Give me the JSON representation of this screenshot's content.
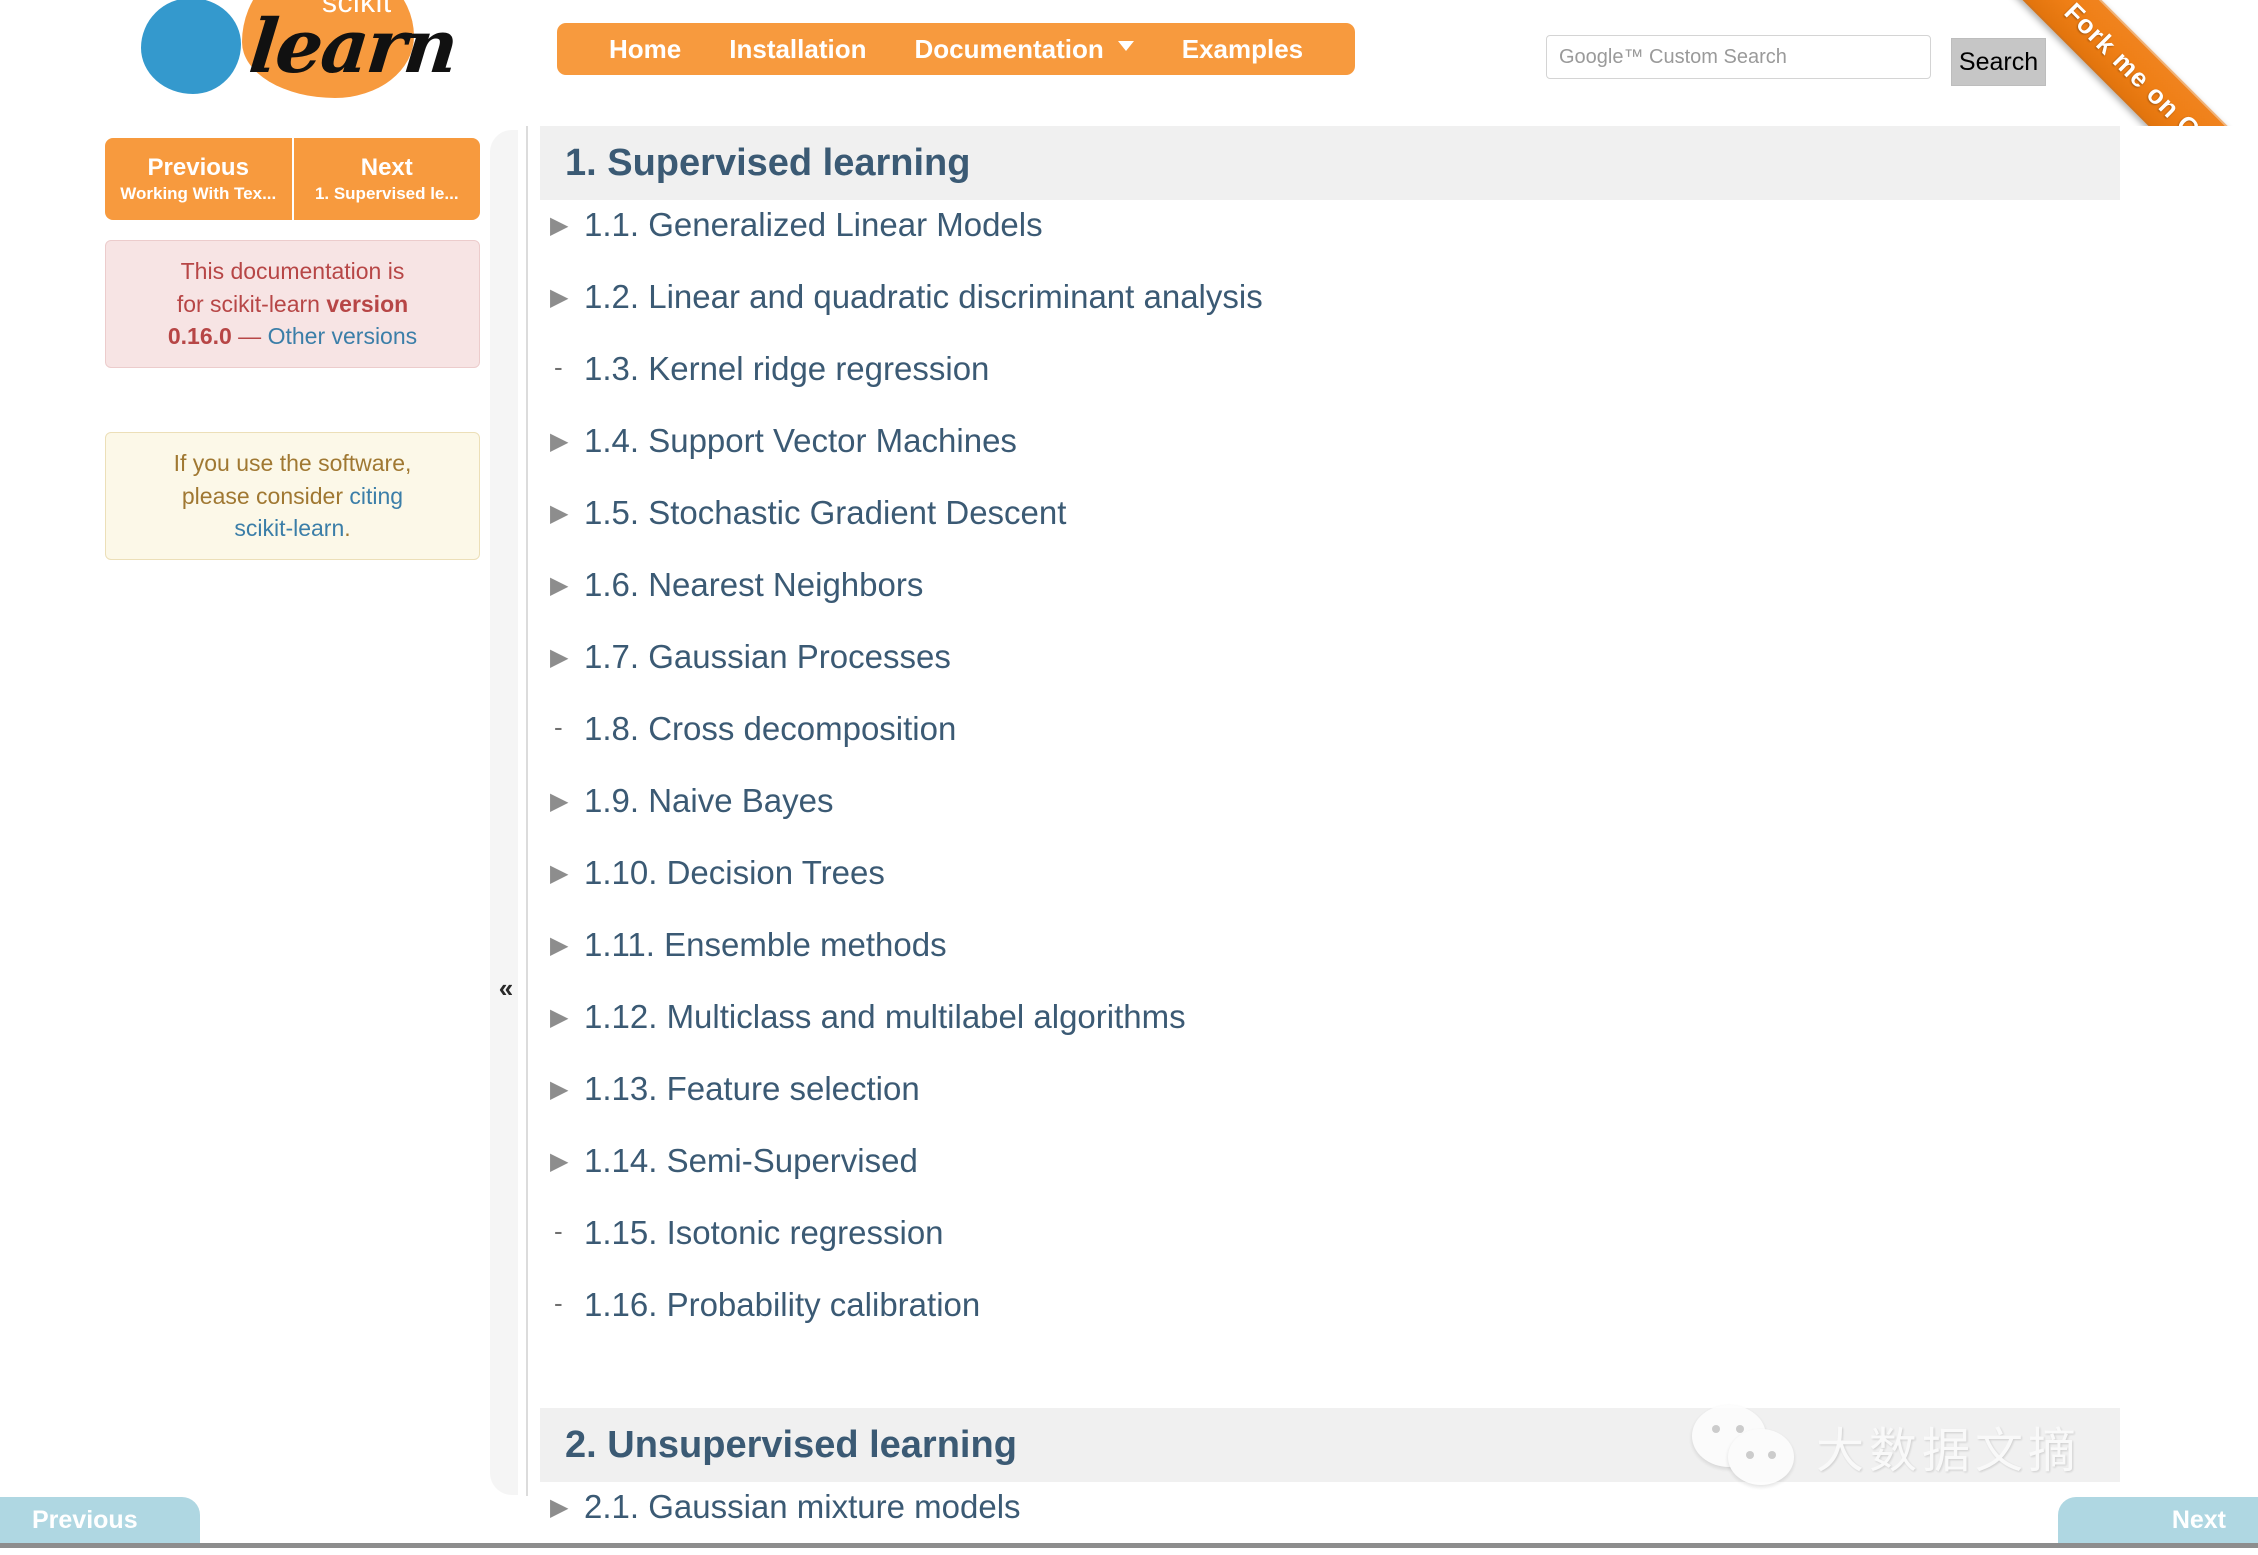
{
  "header": {
    "logo": {
      "scikit": "scikit",
      "learn": "learn"
    },
    "nav": [
      {
        "label": "Home",
        "caret": false
      },
      {
        "label": "Installation",
        "caret": false
      },
      {
        "label": "Documentation",
        "caret": true
      },
      {
        "label": "Examples",
        "caret": false
      }
    ],
    "search": {
      "placeholder": "Google™ Custom Search",
      "value": "",
      "button_label": "Search"
    },
    "ribbon_label": "Fork me on GitHub"
  },
  "sidebar": {
    "prev": {
      "title": "Previous",
      "subtitle": "Working With Tex..."
    },
    "next": {
      "title": "Next",
      "subtitle": "1. Supervised le..."
    },
    "version_box": {
      "line1": "This documentation is",
      "line2_prefix": "for scikit-learn ",
      "line2_bold": "version",
      "line3_bold": "0.16.0",
      "line3_dash": " — ",
      "line3_link": "Other versions"
    },
    "cite_box": {
      "line1": "If you use the software,",
      "line2_prefix": "please consider ",
      "link_part1": "citing",
      "link_part2": "scikit-learn",
      "period": "."
    },
    "collapse_icon": "«"
  },
  "main": {
    "sections": [
      {
        "heading": "1. Supervised learning",
        "items": [
          {
            "marker": "triangle",
            "label": "1.1. Generalized Linear Models"
          },
          {
            "marker": "triangle",
            "label": "1.2. Linear and quadratic discriminant analysis"
          },
          {
            "marker": "dash",
            "label": "1.3. Kernel ridge regression"
          },
          {
            "marker": "triangle",
            "label": "1.4. Support Vector Machines"
          },
          {
            "marker": "triangle",
            "label": "1.5. Stochastic Gradient Descent"
          },
          {
            "marker": "triangle",
            "label": "1.6. Nearest Neighbors"
          },
          {
            "marker": "triangle",
            "label": "1.7. Gaussian Processes"
          },
          {
            "marker": "dash",
            "label": "1.8. Cross decomposition"
          },
          {
            "marker": "triangle",
            "label": "1.9. Naive Bayes"
          },
          {
            "marker": "triangle",
            "label": "1.10. Decision Trees"
          },
          {
            "marker": "triangle",
            "label": "1.11. Ensemble methods"
          },
          {
            "marker": "triangle",
            "label": "1.12. Multiclass and multilabel algorithms"
          },
          {
            "marker": "triangle",
            "label": "1.13. Feature selection"
          },
          {
            "marker": "triangle",
            "label": "1.14. Semi-Supervised"
          },
          {
            "marker": "dash",
            "label": "1.15. Isotonic regression"
          },
          {
            "marker": "dash",
            "label": "1.16. Probability calibration"
          }
        ]
      },
      {
        "heading": "2. Unsupervised learning",
        "items": [
          {
            "marker": "triangle",
            "label": "2.1. Gaussian mixture models"
          }
        ]
      }
    ]
  },
  "footer": {
    "prev_label": "Previous",
    "next_label": "Next"
  },
  "watermark": {
    "text": "大数据文摘"
  },
  "colors": {
    "orange": "#f79a3e",
    "heading_blue": "#3b5a74",
    "link_blue": "#3b7ea8",
    "version_red": "#b74646",
    "cite_brown": "#a07832",
    "tab_blue": "#afd7e2",
    "section_band": "#f0f0f0"
  }
}
